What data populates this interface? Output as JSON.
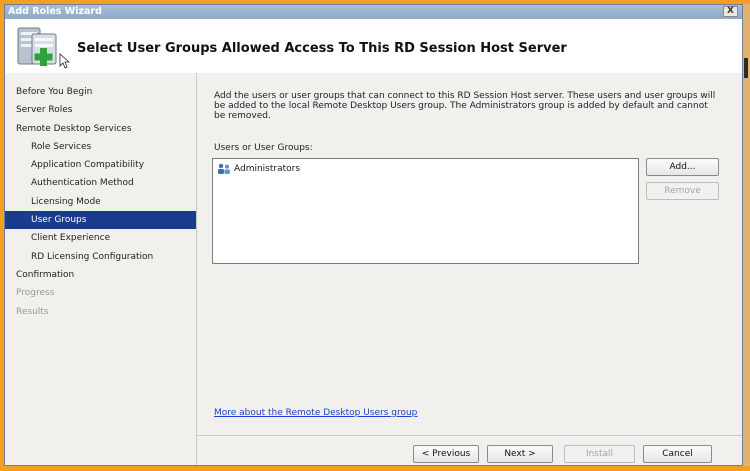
{
  "window": {
    "title": "Add Roles Wizard",
    "close_glyph": "X"
  },
  "header": {
    "title": "Select User Groups Allowed Access To This RD Session Host Server",
    "icon": "server-add-icon"
  },
  "nav": {
    "items": [
      {
        "label": "Before You Begin",
        "level": 0,
        "state": "normal"
      },
      {
        "label": "Server Roles",
        "level": 0,
        "state": "normal"
      },
      {
        "label": "Remote Desktop Services",
        "level": 0,
        "state": "normal"
      },
      {
        "label": "Role Services",
        "level": 1,
        "state": "normal"
      },
      {
        "label": "Application Compatibility",
        "level": 1,
        "state": "normal"
      },
      {
        "label": "Authentication Method",
        "level": 1,
        "state": "normal"
      },
      {
        "label": "Licensing Mode",
        "level": 1,
        "state": "normal"
      },
      {
        "label": "User Groups",
        "level": 1,
        "state": "selected"
      },
      {
        "label": "Client Experience",
        "level": 1,
        "state": "normal"
      },
      {
        "label": "RD Licensing Configuration",
        "level": 1,
        "state": "normal"
      },
      {
        "label": "Confirmation",
        "level": 0,
        "state": "normal"
      },
      {
        "label": "Progress",
        "level": 0,
        "state": "disabled"
      },
      {
        "label": "Results",
        "level": 0,
        "state": "disabled"
      }
    ]
  },
  "content": {
    "description": "Add the users or user groups that can connect to this RD Session Host server. These users and user groups will be added to the local Remote Desktop Users group. The Administrators group is added by default and cannot be removed.",
    "users_label": "Users or User Groups:",
    "list_items": [
      {
        "label": "Administrators",
        "icon": "user-group-icon"
      }
    ],
    "add_label": "Add...",
    "remove_label": "Remove",
    "help_link": "More about the Remote Desktop Users group"
  },
  "footer": {
    "previous_label": "< Previous",
    "next_label": "Next >",
    "install_label": "Install",
    "cancel_label": "Cancel"
  },
  "colors": {
    "frame": "#f3a020",
    "selection": "#1b3b8c",
    "link": "#1f42c8",
    "panel": "#f1f0ec"
  }
}
